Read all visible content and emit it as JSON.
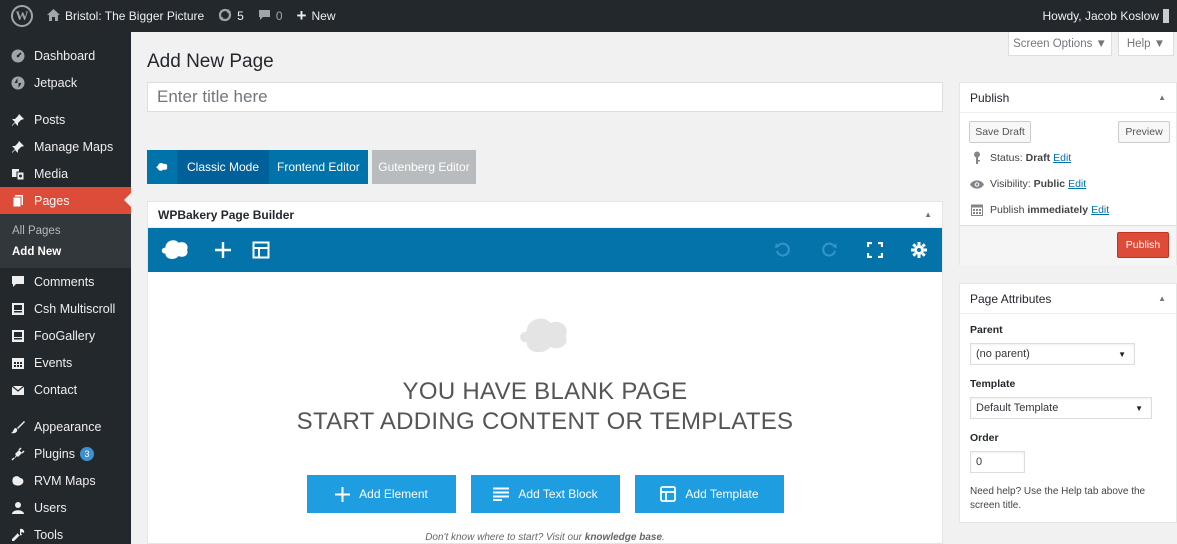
{
  "adminbar": {
    "site_name": "Bristol: The Bigger Picture",
    "updates_count": "5",
    "comments_count": "0",
    "new_label": "New",
    "howdy": "Howdy, Jacob Koslow"
  },
  "sidebar": {
    "items": [
      {
        "label": "Dashboard",
        "icon": "dashboard-icon"
      },
      {
        "label": "Jetpack",
        "icon": "jetpack-icon"
      },
      {
        "label": "Posts",
        "icon": "pin-icon"
      },
      {
        "label": "Manage Maps",
        "icon": "pin-icon"
      },
      {
        "label": "Media",
        "icon": "media-icon"
      },
      {
        "label": "Pages",
        "icon": "pages-icon"
      },
      {
        "label": "Comments",
        "icon": "comments-icon"
      },
      {
        "label": "Csh Multiscroll",
        "icon": "multiscroll-icon"
      },
      {
        "label": "FooGallery",
        "icon": "gallery-icon"
      },
      {
        "label": "Events",
        "icon": "calendar-icon"
      },
      {
        "label": "Contact",
        "icon": "mail-icon"
      },
      {
        "label": "Appearance",
        "icon": "brush-icon"
      },
      {
        "label": "Plugins",
        "icon": "plugin-icon",
        "badge": "3"
      },
      {
        "label": "RVM Maps",
        "icon": "map-icon"
      },
      {
        "label": "Users",
        "icon": "users-icon"
      },
      {
        "label": "Tools",
        "icon": "wrench-icon"
      }
    ],
    "submenu": {
      "all_pages": "All Pages",
      "add_new": "Add New"
    }
  },
  "screen_options": {
    "screen_options_label": "Screen Options ▼",
    "help_label": "Help ▼"
  },
  "main": {
    "title": "Add New Page",
    "title_placeholder": "Enter title here",
    "modes": {
      "classic": "Classic Mode",
      "frontend": "Frontend Editor",
      "gutenberg": "Gutenberg Editor"
    },
    "wpbakery": {
      "box_title": "WPBakery Page Builder",
      "blank_line1": "YOU HAVE BLANK PAGE",
      "blank_line2": "START ADDING CONTENT OR TEMPLATES",
      "add_element": "Add Element",
      "add_text_block": "Add Text Block",
      "add_template": "Add Template",
      "hint_prefix": "Don't know where to start? Visit our",
      "hint_link": "knowledge base",
      "hint_suffix": "."
    }
  },
  "publish": {
    "title": "Publish",
    "save_draft": "Save Draft",
    "preview": "Preview",
    "status_label": "Status:",
    "status_value": "Draft",
    "visibility_label": "Visibility:",
    "visibility_value": "Public",
    "publish_label": "Publish",
    "publish_value": "immediately",
    "edit": "Edit",
    "publish_button": "Publish",
    "accent_color": "#dd4b39"
  },
  "page_attributes": {
    "title": "Page Attributes",
    "parent_label": "Parent",
    "parent_value": "(no parent)",
    "template_label": "Template",
    "template_value": "Default Template",
    "order_label": "Order",
    "order_value": "0",
    "help_text": "Need help? Use the Help tab above the screen title."
  }
}
